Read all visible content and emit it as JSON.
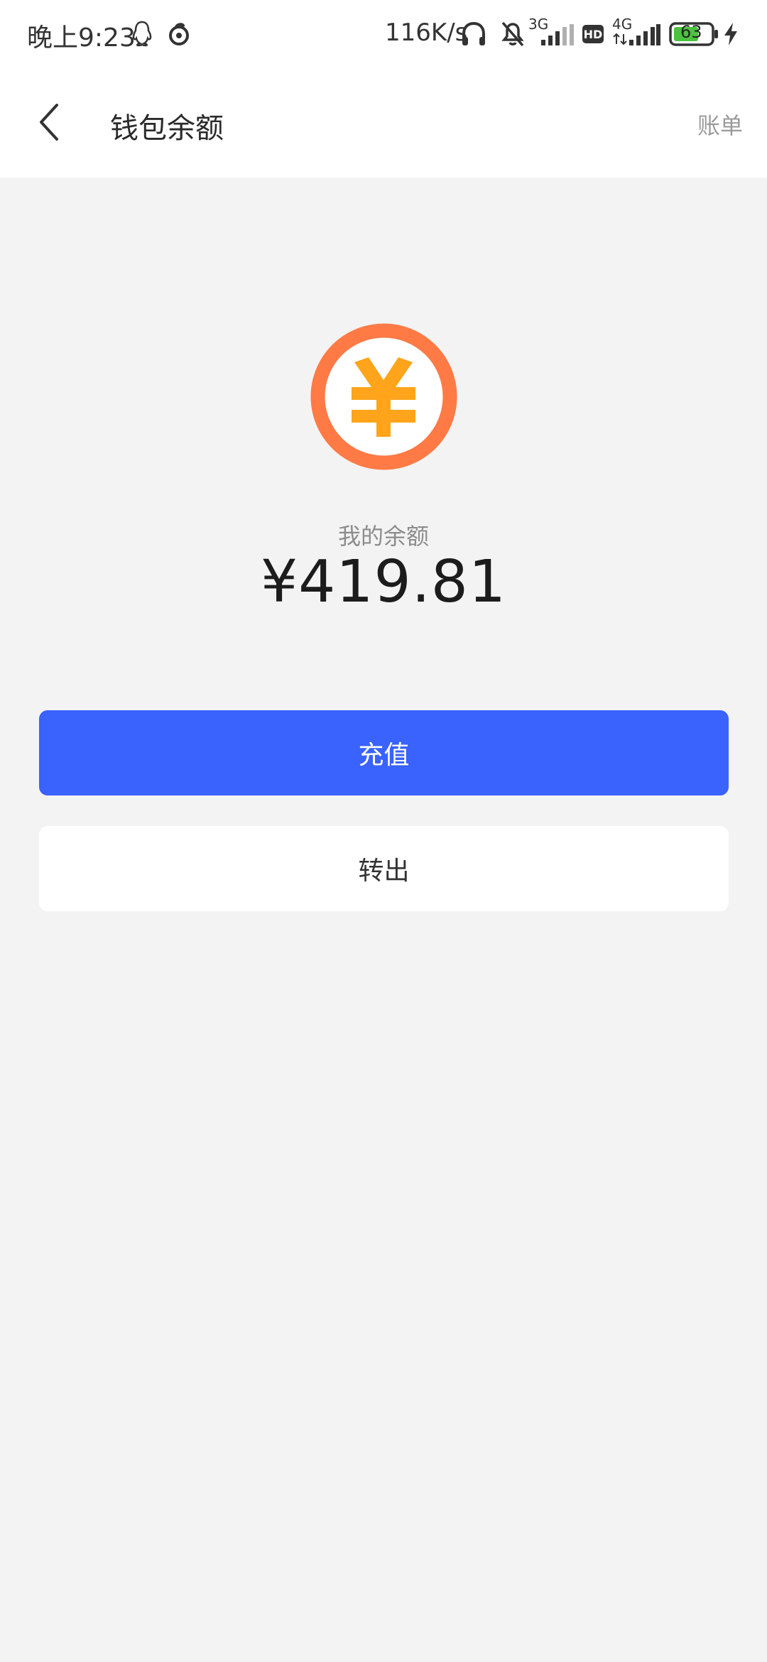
{
  "status_bar": {
    "time": "晚上9:23",
    "speed": "116K/s",
    "network_3g": "3G",
    "network_4g": "4G",
    "hd_label": "HD",
    "battery": "63",
    "icons": [
      "qq-icon",
      "netease-music-icon",
      "headphones-icon",
      "bell-muted-icon",
      "signal-3g-icon",
      "hd-icon",
      "signal-4g-icon",
      "battery-icon",
      "charging-icon"
    ]
  },
  "header": {
    "title": "钱包余额",
    "right_link": "账单"
  },
  "balance": {
    "label": "我的余额",
    "amount": "¥419.81"
  },
  "actions": {
    "recharge": "充值",
    "transfer_out": "转出"
  },
  "colors": {
    "primary": "#3a62fc",
    "coin_ring": "#ff7a45",
    "coin_symbol": "#ffa41b",
    "background": "#f3f3f3"
  }
}
